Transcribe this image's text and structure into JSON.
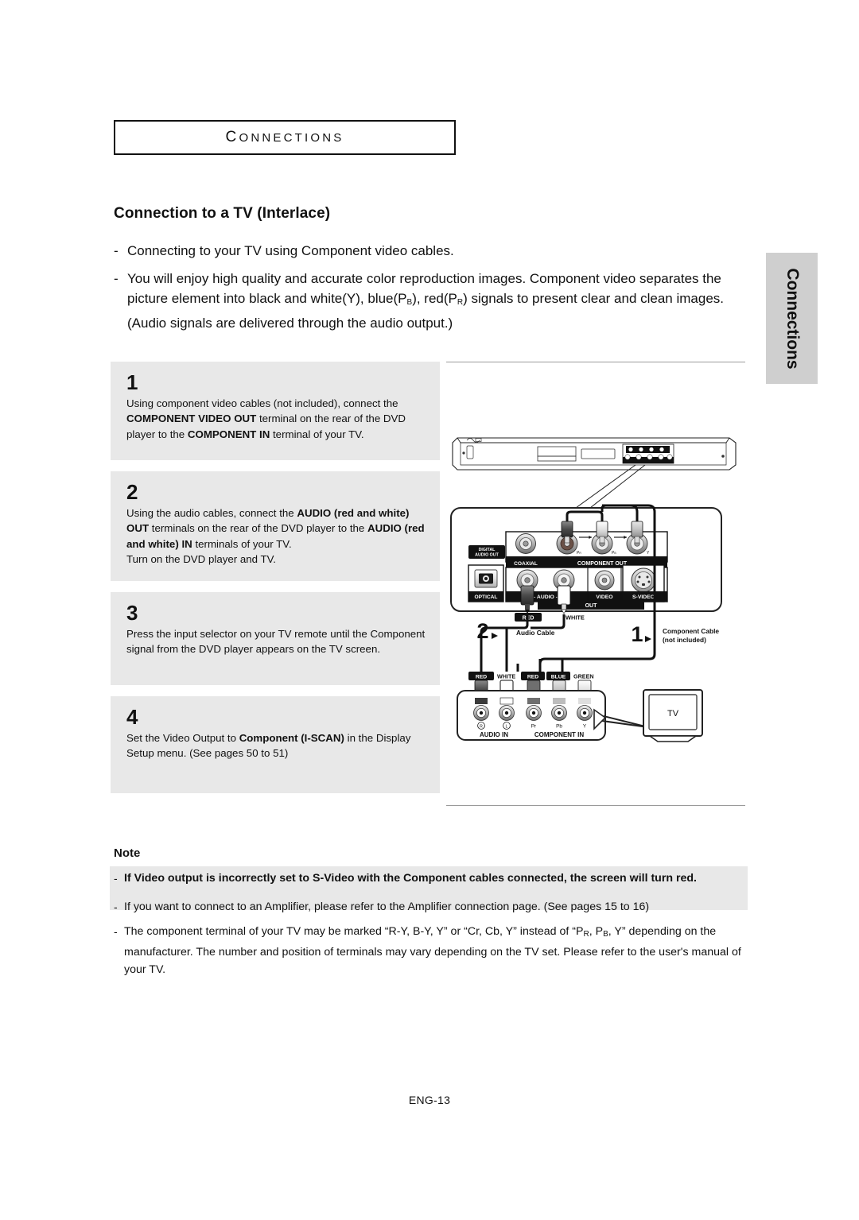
{
  "chapter": {
    "label": "CONNECTIONS"
  },
  "section": {
    "heading": "Connection to a TV (Interlace)"
  },
  "intro": {
    "bullets": [
      "Connecting to your TV using Component video cables.",
      "You will enjoy high quality and accurate color reproduction images. Component video separates the picture element into black and white(Y), blue(PB), red(PR) signals to present clear and clean images. (Audio signals are delivered through the audio output.)"
    ],
    "dash": "-"
  },
  "side_tab": {
    "label": "Connections"
  },
  "steps": [
    {
      "number": "1",
      "text": "Using component video cables (not included), connect the COMPONENT VIDEO OUT terminal on the rear of the DVD player to the COMPONENT IN terminal of your TV."
    },
    {
      "number": "2",
      "text": "Using the audio cables, connect the AUDIO (red and white) OUT terminals on the rear of the DVD player to the AUDIO (red and white) IN terminals of your TV. Turn on the DVD player and TV."
    },
    {
      "number": "3",
      "text": "Press the input selector on your TV remote until the Component signal from the DVD player appears on the TV screen."
    },
    {
      "number": "4",
      "text": "Set the Video Output to Component (I-SCAN) in the Display Setup menu. (See pages 50 to 51)"
    }
  ],
  "diagram": {
    "dvd_rear_panel": {
      "digital_audio_out": "DIGITAL AUDIO OUT",
      "coaxial": "COAXIAL",
      "optical": "OPTICAL",
      "component_out": "COMPONENT OUT",
      "component_jacks": [
        "PR",
        "PB",
        "Y"
      ],
      "audio": "AUDIO",
      "out": "OUT",
      "video": "VIDEO",
      "s_video": "S-VIDEO"
    },
    "cables": {
      "audio_plug_red": "RED",
      "audio_plug_white": "WHITE",
      "audio_cable_label": "Audio Cable",
      "audio_step_badge": "2",
      "component_cable_label": "Component Cable",
      "component_cable_sub": "(not included)",
      "component_step_badge": "1"
    },
    "tv_panel": {
      "audio_red": "RED",
      "audio_white": "WHITE",
      "comp_red": "RED",
      "comp_blue": "BLUE",
      "comp_green": "GREEN",
      "audio_in": "AUDIO IN",
      "component_in": "COMPONENT IN",
      "jack_r": "R",
      "jack_l": "L",
      "jack_pr": "Pr",
      "jack_pb": "Pb",
      "jack_y": "Y",
      "tv_label": "TV"
    }
  },
  "note": {
    "label": "Note",
    "dash": "-",
    "items": [
      "If Video output is incorrectly set to S-Video with the Component cables connected, the screen will turn red.",
      "If you want to connect to an Amplifier, please refer to the Amplifier connection page. (See pages 15 to 16)",
      "The component terminal of your TV may be marked “R-Y, B-Y, Y” or “Cr, Cb, Y” instead of “PR, PB, Y” depending on the manufacturer. The number and position of terminals may vary depending on the TV set. Please refer to the user's manual of your TV."
    ]
  },
  "footer": {
    "page": "ENG-13"
  },
  "colors": {
    "step_bg": "#e8e8e8",
    "tab_bg": "#cfcfcf",
    "rule": "#9a9a9a",
    "text": "#111111"
  }
}
